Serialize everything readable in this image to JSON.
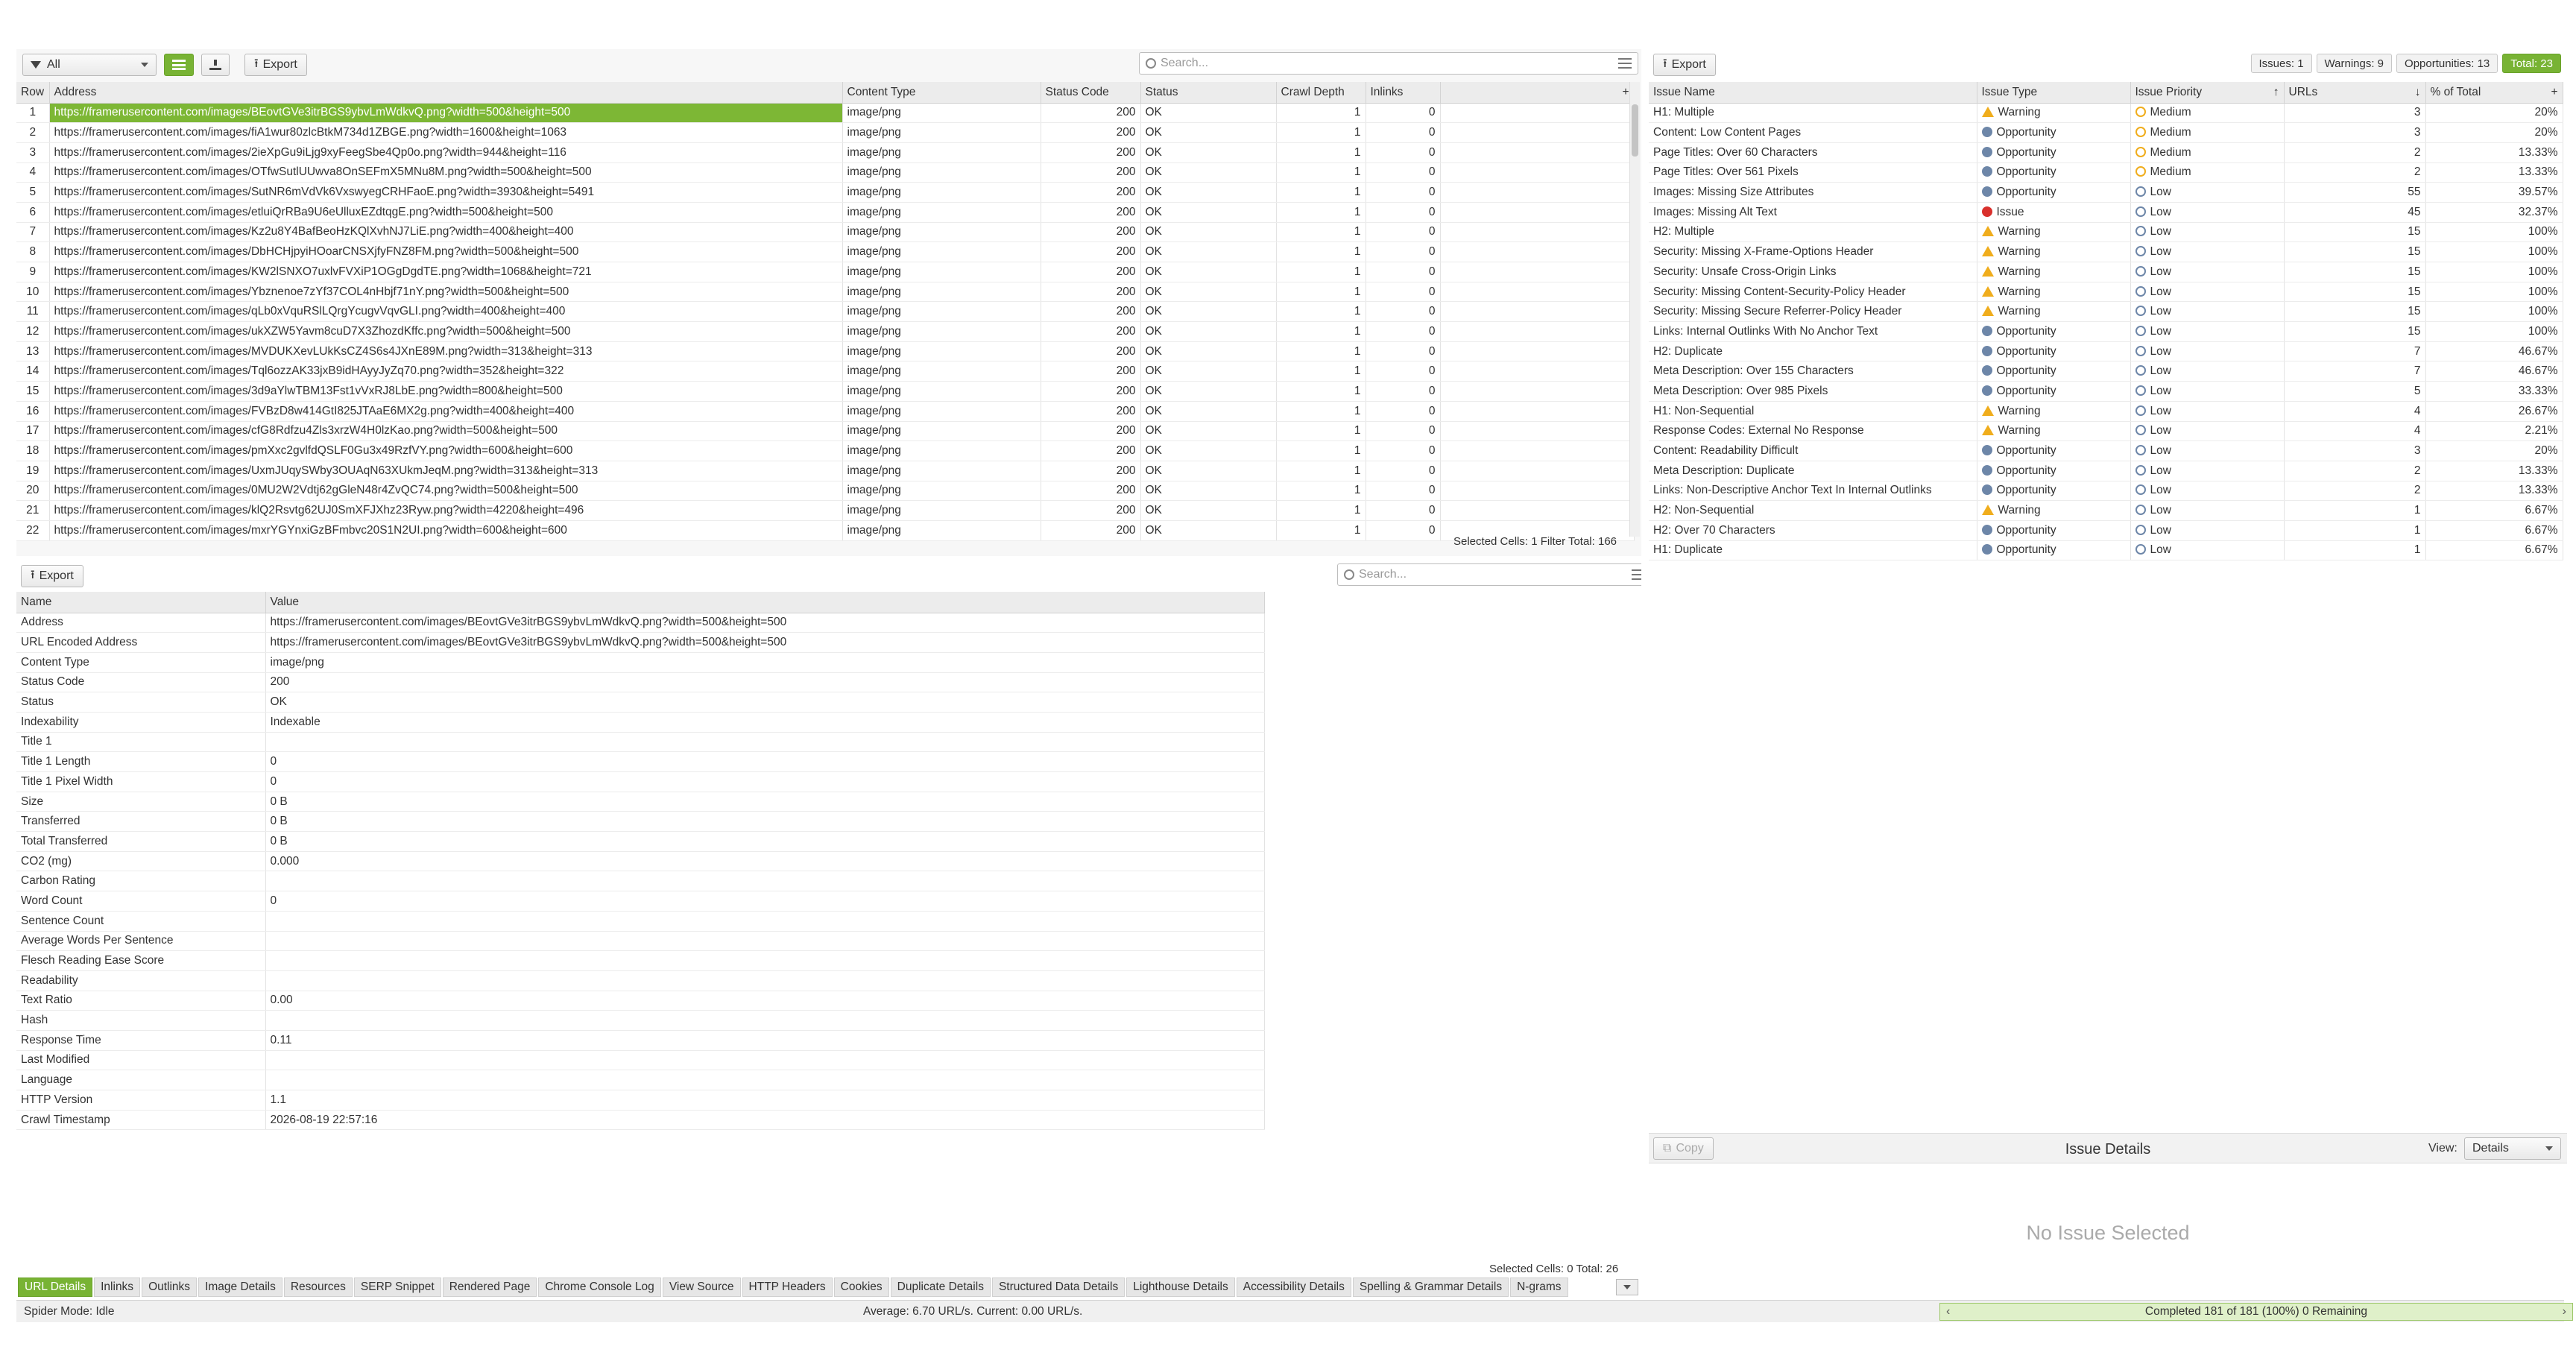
{
  "top_left": {
    "filter": "All",
    "export_label": "Export",
    "search_placeholder": "Search...",
    "columns": [
      "Row",
      "Address",
      "Content Type",
      "Status Code",
      "Status",
      "Crawl Depth",
      "Inlinks"
    ],
    "rows": [
      [
        "1",
        "https://framerusercontent.com/images/BEovtGVe3itrBGS9ybvLmWdkvQ.png?width=500&height=500",
        "image/png",
        "200",
        "OK",
        "1",
        "0"
      ],
      [
        "2",
        "https://framerusercontent.com/images/fiA1wur80zlcBtkM734d1ZBGE.png?width=1600&height=1063",
        "image/png",
        "200",
        "OK",
        "1",
        "0"
      ],
      [
        "3",
        "https://framerusercontent.com/images/2ieXpGu9iLjg9xyFeegSbe4Qp0o.png?width=944&height=116",
        "image/png",
        "200",
        "OK",
        "1",
        "0"
      ],
      [
        "4",
        "https://framerusercontent.com/images/OTfwSutlUUwva8OnSEFmX5MNu8M.png?width=500&height=500",
        "image/png",
        "200",
        "OK",
        "1",
        "0"
      ],
      [
        "5",
        "https://framerusercontent.com/images/SutNR6mVdVk6VxswyegCRHFaoE.png?width=3930&height=5491",
        "image/png",
        "200",
        "OK",
        "1",
        "0"
      ],
      [
        "6",
        "https://framerusercontent.com/images/etluiQrRBa9U6eUlluxEZdtqgE.png?width=500&height=500",
        "image/png",
        "200",
        "OK",
        "1",
        "0"
      ],
      [
        "7",
        "https://framerusercontent.com/images/Kz2u8Y4BafBeoHzKQlXvhNJ7LiE.png?width=400&height=400",
        "image/png",
        "200",
        "OK",
        "1",
        "0"
      ],
      [
        "8",
        "https://framerusercontent.com/images/DbHCHjpyiHOoarCNSXjfyFNZ8FM.png?width=500&height=500",
        "image/png",
        "200",
        "OK",
        "1",
        "0"
      ],
      [
        "9",
        "https://framerusercontent.com/images/KW2lSNXO7uxlvFVXiP1OGgDgdTE.png?width=1068&height=721",
        "image/png",
        "200",
        "OK",
        "1",
        "0"
      ],
      [
        "10",
        "https://framerusercontent.com/images/Ybznenoe7zYf37COL4nHbjf71nY.png?width=500&height=500",
        "image/png",
        "200",
        "OK",
        "1",
        "0"
      ],
      [
        "11",
        "https://framerusercontent.com/images/qLb0xVquRSlLQrgYcugvVqvGLI.png?width=400&height=400",
        "image/png",
        "200",
        "OK",
        "1",
        "0"
      ],
      [
        "12",
        "https://framerusercontent.com/images/ukXZW5Yavm8cuD7X3ZhozdKffc.png?width=500&height=500",
        "image/png",
        "200",
        "OK",
        "1",
        "0"
      ],
      [
        "13",
        "https://framerusercontent.com/images/MVDUKXevLUkKsCZ4S6s4JXnE89M.png?width=313&height=313",
        "image/png",
        "200",
        "OK",
        "1",
        "0"
      ],
      [
        "14",
        "https://framerusercontent.com/images/Tql6ozzAK33jxB9idHAyyJyZq70.png?width=352&height=322",
        "image/png",
        "200",
        "OK",
        "1",
        "0"
      ],
      [
        "15",
        "https://framerusercontent.com/images/3d9aYlwTBM13Fst1vVxRJ8LbE.png?width=800&height=500",
        "image/png",
        "200",
        "OK",
        "1",
        "0"
      ],
      [
        "16",
        "https://framerusercontent.com/images/FVBzD8w414GtI825JTAaE6MX2g.png?width=400&height=400",
        "image/png",
        "200",
        "OK",
        "1",
        "0"
      ],
      [
        "17",
        "https://framerusercontent.com/images/cfG8Rdfzu4Zls3xrzW4H0lzKao.png?width=500&height=500",
        "image/png",
        "200",
        "OK",
        "1",
        "0"
      ],
      [
        "18",
        "https://framerusercontent.com/images/pmXxc2gvlfdQSLF0Gu3x49RzfVY.png?width=600&height=600",
        "image/png",
        "200",
        "OK",
        "1",
        "0"
      ],
      [
        "19",
        "https://framerusercontent.com/images/UxmJUqySWby3OUAqN63XUkmJeqM.png?width=313&height=313",
        "image/png",
        "200",
        "OK",
        "1",
        "0"
      ],
      [
        "20",
        "https://framerusercontent.com/images/0MU2W2Vdtj62gGleN48r4ZvQC74.png?width=500&height=500",
        "image/png",
        "200",
        "OK",
        "1",
        "0"
      ],
      [
        "21",
        "https://framerusercontent.com/images/klQ2Rsvtg62UJ0SmXFJXhz23Ryw.png?width=4220&height=496",
        "image/png",
        "200",
        "OK",
        "1",
        "0"
      ],
      [
        "22",
        "https://framerusercontent.com/images/mxrYGYnxiGzBFmbvc20S1N2UI.png?width=600&height=600",
        "image/png",
        "200",
        "OK",
        "1",
        "0"
      ]
    ],
    "status": "Selected Cells:  1  Filter Total:  166"
  },
  "bottom_left": {
    "export_label": "Export",
    "search_placeholder": "Search...",
    "columns": [
      "Name",
      "Value"
    ],
    "rows": [
      [
        "Address",
        "https://framerusercontent.com/images/BEovtGVe3itrBGS9ybvLmWdkvQ.png?width=500&height=500"
      ],
      [
        "URL Encoded Address",
        "https://framerusercontent.com/images/BEovtGVe3itrBGS9ybvLmWdkvQ.png?width=500&height=500"
      ],
      [
        "Content Type",
        "image/png"
      ],
      [
        "Status Code",
        "200"
      ],
      [
        "Status",
        "OK"
      ],
      [
        "Indexability",
        "Indexable"
      ],
      [
        "Title 1",
        ""
      ],
      [
        "Title 1 Length",
        "0"
      ],
      [
        "Title 1 Pixel Width",
        "0"
      ],
      [
        "Size",
        "0 B"
      ],
      [
        "Transferred",
        "0 B"
      ],
      [
        "Total Transferred",
        "0 B"
      ],
      [
        "CO2 (mg)",
        "0.000"
      ],
      [
        "Carbon Rating",
        ""
      ],
      [
        "Word Count",
        "0"
      ],
      [
        "Sentence Count",
        ""
      ],
      [
        "Average Words Per Sentence",
        ""
      ],
      [
        "Flesch Reading Ease Score",
        ""
      ],
      [
        "Readability",
        ""
      ],
      [
        "Text Ratio",
        "0.00"
      ],
      [
        "Hash",
        ""
      ],
      [
        "Response Time",
        "0.11"
      ],
      [
        "Last Modified",
        ""
      ],
      [
        "Language",
        ""
      ],
      [
        "HTTP Version",
        "1.1"
      ],
      [
        "Crawl Timestamp",
        "2026-08-19 22:57:16"
      ]
    ],
    "status": "Selected Cells:  0  Total:  26",
    "tabs": [
      "URL Details",
      "Inlinks",
      "Outlinks",
      "Image Details",
      "Resources",
      "SERP Snippet",
      "Rendered Page",
      "Chrome Console Log",
      "View Source",
      "HTTP Headers",
      "Cookies",
      "Duplicate Details",
      "Structured Data Details",
      "Lighthouse Details",
      "Accessibility Details",
      "Spelling & Grammar Details",
      "N-grams"
    ]
  },
  "right": {
    "export_label": "Export",
    "badges": {
      "issues": "Issues: 1",
      "warnings": "Warnings: 9",
      "opportunities": "Opportunities: 13",
      "total": "Total: 23"
    },
    "columns": [
      "Issue Name",
      "Issue Type",
      "Issue Priority",
      "URLs",
      "% of Total"
    ],
    "rows": [
      [
        "H1: Multiple",
        "Warning",
        "Medium",
        "3",
        "20%"
      ],
      [
        "Content: Low Content Pages",
        "Opportunity",
        "Medium",
        "3",
        "20%"
      ],
      [
        "Page Titles: Over 60 Characters",
        "Opportunity",
        "Medium",
        "2",
        "13.33%"
      ],
      [
        "Page Titles: Over 561 Pixels",
        "Opportunity",
        "Medium",
        "2",
        "13.33%"
      ],
      [
        "Images: Missing Size Attributes",
        "Opportunity",
        "Low",
        "55",
        "39.57%"
      ],
      [
        "Images: Missing Alt Text",
        "Issue",
        "Low",
        "45",
        "32.37%"
      ],
      [
        "H2: Multiple",
        "Warning",
        "Low",
        "15",
        "100%"
      ],
      [
        "Security: Missing X-Frame-Options Header",
        "Warning",
        "Low",
        "15",
        "100%"
      ],
      [
        "Security: Unsafe Cross-Origin Links",
        "Warning",
        "Low",
        "15",
        "100%"
      ],
      [
        "Security: Missing Content-Security-Policy Header",
        "Warning",
        "Low",
        "15",
        "100%"
      ],
      [
        "Security: Missing Secure Referrer-Policy Header",
        "Warning",
        "Low",
        "15",
        "100%"
      ],
      [
        "Links: Internal Outlinks With No Anchor Text",
        "Opportunity",
        "Low",
        "15",
        "100%"
      ],
      [
        "H2: Duplicate",
        "Opportunity",
        "Low",
        "7",
        "46.67%"
      ],
      [
        "Meta Description: Over 155 Characters",
        "Opportunity",
        "Low",
        "7",
        "46.67%"
      ],
      [
        "Meta Description: Over 985 Pixels",
        "Opportunity",
        "Low",
        "5",
        "33.33%"
      ],
      [
        "H1: Non-Sequential",
        "Warning",
        "Low",
        "4",
        "26.67%"
      ],
      [
        "Response Codes: External No Response",
        "Warning",
        "Low",
        "4",
        "2.21%"
      ],
      [
        "Content: Readability Difficult",
        "Opportunity",
        "Low",
        "3",
        "20%"
      ],
      [
        "Meta Description: Duplicate",
        "Opportunity",
        "Low",
        "2",
        "13.33%"
      ],
      [
        "Links: Non-Descriptive Anchor Text In Internal Outlinks",
        "Opportunity",
        "Low",
        "2",
        "13.33%"
      ],
      [
        "H2: Non-Sequential",
        "Warning",
        "Low",
        "1",
        "6.67%"
      ],
      [
        "H2: Over 70 Characters",
        "Opportunity",
        "Low",
        "1",
        "6.67%"
      ],
      [
        "H1: Duplicate",
        "Opportunity",
        "Low",
        "1",
        "6.67%"
      ]
    ],
    "details": {
      "copy_label": "Copy",
      "title": "Issue Details",
      "view_label": "View:",
      "view_value": "Details",
      "empty_text": "No Issue Selected"
    }
  },
  "footer": {
    "spider_mode": "Spider Mode: Idle",
    "speed": "Average: 6.70 URL/s. Current: 0.00 URL/s.",
    "progress": "Completed 181 of 181 (100%) 0 Remaining",
    "progress_fraction": 1.0
  },
  "colors": {
    "accent": "#78b334",
    "warning": "#f0ad1c",
    "info": "#6d86a8",
    "issue": "#d9302c"
  }
}
